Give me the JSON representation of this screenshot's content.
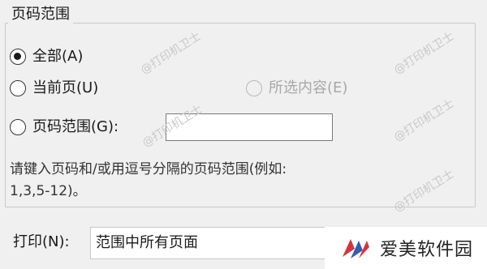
{
  "group": {
    "title": "页码范围"
  },
  "options": {
    "all": {
      "label": "全部(A)",
      "checked": true
    },
    "current": {
      "label": "当前页(U)"
    },
    "selection": {
      "label": "所选内容(E)"
    },
    "pages": {
      "label": "页码范围(G):",
      "value": ""
    }
  },
  "hint": {
    "line1": "请键入页码和/或用逗号分隔的页码范围(例如:",
    "line2": "1,3,5-12)。"
  },
  "print": {
    "label": "打印(N):",
    "selected": "范围中所有页面"
  },
  "watermark": "@打印机卫士",
  "logo": {
    "text": "爱美软件园"
  }
}
